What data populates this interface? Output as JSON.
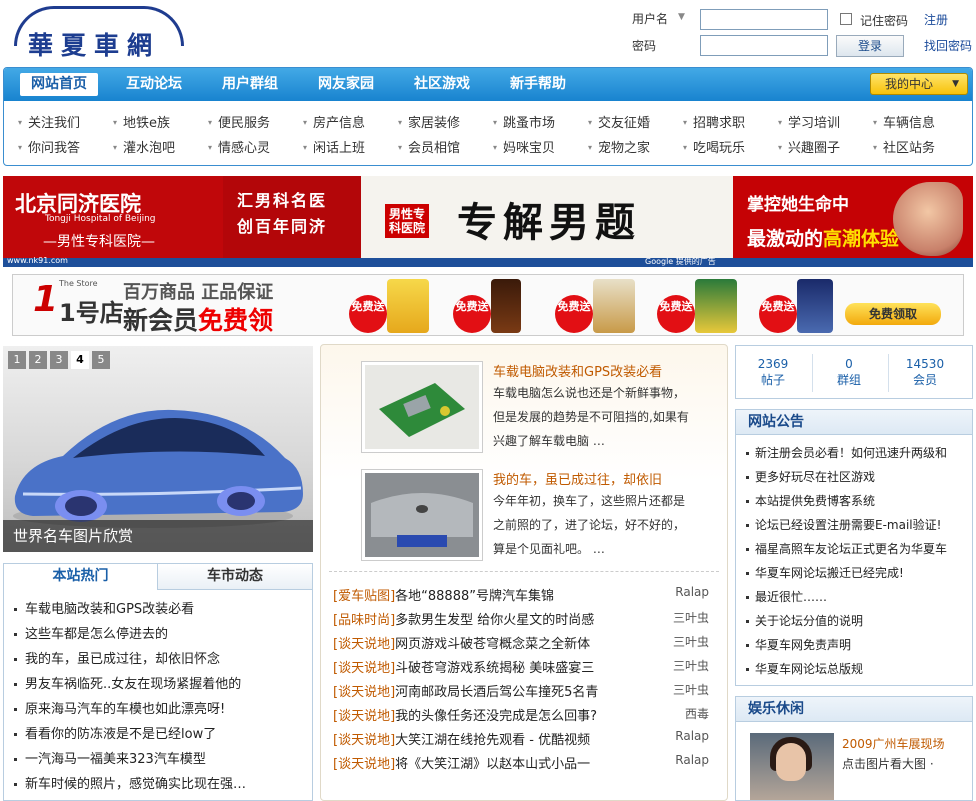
{
  "logo": {
    "text": "華夏車網"
  },
  "login": {
    "username_label": "用户名",
    "password_label": "密码",
    "remember_label": "记住密码",
    "login_button": "登录",
    "register_link": "注册",
    "forgot_link": "找回密码"
  },
  "nav": {
    "tabs": [
      "网站首页",
      "互动论坛",
      "用户群组",
      "网友家园",
      "社区游戏",
      "新手帮助"
    ],
    "my_center": "我的中心",
    "sub_row1": [
      "关注我们",
      "地铁e族",
      "便民服务",
      "房产信息",
      "家居装修",
      "跳蚤市场",
      "交友征婚",
      "招聘求职",
      "学习培训",
      "车辆信息"
    ],
    "sub_row2": [
      "你问我答",
      "灌水泡吧",
      "情感心灵",
      "闲话上班",
      "会员相馆",
      "妈咪宝贝",
      "宠物之家",
      "吃喝玩乐",
      "兴趣圈子",
      "社区站务"
    ]
  },
  "ads": {
    "hospital_name": "北京同济医院",
    "hospital_en": "Tongji Hospital of Beijing",
    "hospital_sub": "—男性专科医院—",
    "slogan1": "汇男科名医",
    "slogan2": "创百年同济",
    "male_badge": "男性专科医院",
    "big_text": "专解男题",
    "right1": "掌控她生命中",
    "right2a": "最激动的",
    "right2b": "高潮体验",
    "site_url": "www.nk91.com",
    "google_note": "Google 提供的广告",
    "store_logo": "1号店",
    "store_small": "The Store",
    "store_line1": "百万商品 正品保证",
    "store_line2a": "新会员",
    "store_line2b": "免费领",
    "free_badge": "免费送",
    "free_button": "免费领取"
  },
  "slider": {
    "numbers": [
      "1",
      "2",
      "3",
      "4",
      "5"
    ],
    "active_index": 4,
    "caption": "世界名车图片欣赏"
  },
  "hot": {
    "tabs": [
      "本站热门",
      "车市动态"
    ],
    "items": [
      "车载电脑改装和GPS改装必看",
      "这些车都是怎么停进去的",
      "我的车，虽已成过往，却依旧怀念",
      "男友车祸临死..女友在现场紧握着他的",
      "原来海马汽车的车模也如此漂亮呀!",
      "看看你的防冻液是不是已经low了",
      "一汽海马一福美来323汽车模型",
      "新车时候的照片，感觉确实比现在强…"
    ]
  },
  "featured": [
    {
      "title": "车载电脑改装和GPS改装必看",
      "desc": "车载电脑怎么说也还是个新鲜事物，但是发展的趋势是不可阻挡的,如果有兴趣了解车载电脑 …"
    },
    {
      "title": "我的车，虽已成过往，却依旧",
      "desc": "今年年初，换车了，这些照片还都是之前照的了，进了论坛，好不好的，算是个见面礼吧。 …"
    }
  ],
  "news": [
    {
      "cat": "[爱车贴图]",
      "title": "各地“88888”号牌汽车集锦",
      "author": "Ralap"
    },
    {
      "cat": "[品味时尚]",
      "title": "多款男生发型 给你火星文的时尚感",
      "author": "三叶虫"
    },
    {
      "cat": "[谈天说地]",
      "title": "网页游戏斗破苍穹概念菜之全新体",
      "author": "三叶虫"
    },
    {
      "cat": "[谈天说地]",
      "title": "斗破苍穹游戏系统揭秘 美味盛宴三",
      "author": "三叶虫"
    },
    {
      "cat": "[谈天说地]",
      "title": "河南邮政局长酒后驾公车撞死5名青",
      "author": "三叶虫"
    },
    {
      "cat": "[谈天说地]",
      "title": "我的头像任务还没完成是怎么回事?",
      "author": "西毒"
    },
    {
      "cat": "[谈天说地]",
      "title": "大笑江湖在线抢先观看 - 优酷视频",
      "author": "Ralap"
    },
    {
      "cat": "[谈天说地]",
      "title": "将《大笑江湖》以赵本山式小品一",
      "author": "Ralap"
    }
  ],
  "stats": [
    {
      "value": "2369",
      "label": "帖子"
    },
    {
      "value": "0",
      "label": "群组"
    },
    {
      "value": "14530",
      "label": "会员"
    }
  ],
  "announcements": {
    "title": "网站公告",
    "items": [
      "新注册会员必看！如何迅速升两级和",
      "更多好玩尽在社区游戏",
      "本站提供免费博客系统",
      "论坛已经设置注册需要E-mail验证!",
      "福星高照车友论坛正式更名为华夏车",
      "华夏车网论坛搬迁已经完成!",
      "最近很忙……",
      "关于论坛分值的说明",
      "华夏车网免责声明",
      "华夏车网论坛总版规"
    ]
  },
  "entertainment": {
    "title": "娱乐休闲",
    "item_title": "2009广州车展现场",
    "item_desc": "点击图片看大图 ·"
  }
}
